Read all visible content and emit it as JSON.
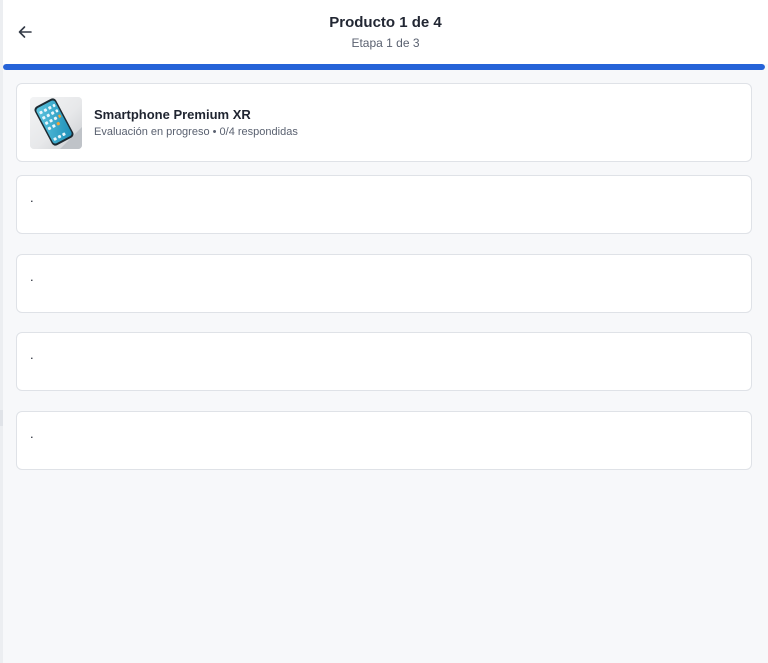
{
  "header": {
    "back_icon": "arrow-left-icon",
    "title": "Producto 1 de 4",
    "subtitle": "Etapa 1 de 3"
  },
  "progress": {
    "fraction": 1.0,
    "color": "#2663d8"
  },
  "product": {
    "name": "Smartphone Premium XR",
    "status": "Evaluación en progreso • 0/4 respondidas",
    "image_icon": "smartphone-image"
  },
  "questions": [
    {
      "text": "."
    },
    {
      "text": "."
    },
    {
      "text": "."
    },
    {
      "text": "."
    }
  ],
  "colors": {
    "accent": "#2663d8",
    "background": "#f7f8fa",
    "card": "#ffffff"
  }
}
